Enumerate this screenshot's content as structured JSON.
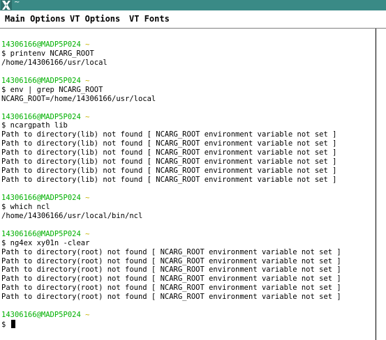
{
  "window": {
    "title": "~",
    "titlebar_color": "#3a8a86"
  },
  "menu": {
    "main_options": "Main Options",
    "vt_options": "VT Options",
    "vt_fonts": "VT Fonts"
  },
  "prompt": {
    "user_host": "14306166@MADP5P024",
    "path": "~",
    "symbol": "$",
    "user_color": "#00b000",
    "path_color": "#c8b400"
  },
  "terminal": {
    "blocks": [
      {
        "command": "printenv NCARG_ROOT",
        "output": [
          "/home/14306166/usr/local"
        ]
      },
      {
        "command": "env | grep NCARG_ROOT",
        "output": [
          "NCARG_ROOT=/home/14306166/usr/local"
        ]
      },
      {
        "command": "ncargpath lib",
        "output": [
          "Path to directory(lib) not found [ NCARG_ROOT environment variable not set ]",
          "Path to directory(lib) not found [ NCARG_ROOT environment variable not set ]",
          "Path to directory(lib) not found [ NCARG_ROOT environment variable not set ]",
          "Path to directory(lib) not found [ NCARG_ROOT environment variable not set ]",
          "Path to directory(lib) not found [ NCARG_ROOT environment variable not set ]",
          "Path to directory(lib) not found [ NCARG_ROOT environment variable not set ]"
        ]
      },
      {
        "command": "which ncl",
        "output": [
          "/home/14306166/usr/local/bin/ncl"
        ]
      },
      {
        "command": "ng4ex xy01n -clear",
        "output": [
          "Path to directory(root) not found [ NCARG_ROOT environment variable not set ]",
          "Path to directory(root) not found [ NCARG_ROOT environment variable not set ]",
          "Path to directory(root) not found [ NCARG_ROOT environment variable not set ]",
          "Path to directory(root) not found [ NCARG_ROOT environment variable not set ]",
          "Path to directory(root) not found [ NCARG_ROOT environment variable not set ]",
          "Path to directory(root) not found [ NCARG_ROOT environment variable not set ]"
        ]
      }
    ],
    "current_command": ""
  }
}
